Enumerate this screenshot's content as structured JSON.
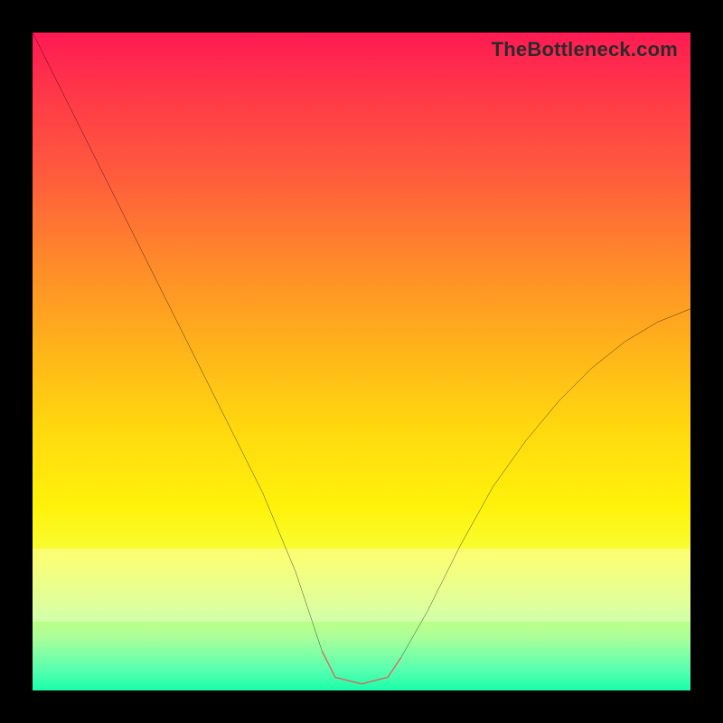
{
  "watermark": {
    "text": "TheBottleneck.com"
  },
  "chart_data": {
    "type": "line",
    "title": "",
    "xlabel": "",
    "ylabel": "",
    "xlim": [
      0,
      100
    ],
    "ylim": [
      0,
      100
    ],
    "series": [
      {
        "name": "main-curve",
        "color": "#000000",
        "x": [
          0,
          5,
          10,
          15,
          20,
          25,
          30,
          35,
          40,
          44,
          46,
          50,
          54,
          56,
          60,
          65,
          70,
          75,
          80,
          85,
          90,
          95,
          100
        ],
        "values": [
          100,
          90,
          80,
          70,
          60,
          50,
          40,
          30,
          18,
          6,
          2,
          1,
          2,
          5,
          12,
          22,
          31,
          38,
          44,
          49,
          53,
          56,
          58
        ]
      },
      {
        "name": "highlight-segment",
        "color": "#d96a60",
        "x": [
          44,
          46,
          50,
          54,
          56
        ],
        "values": [
          6,
          2,
          1,
          2,
          5
        ]
      }
    ]
  }
}
